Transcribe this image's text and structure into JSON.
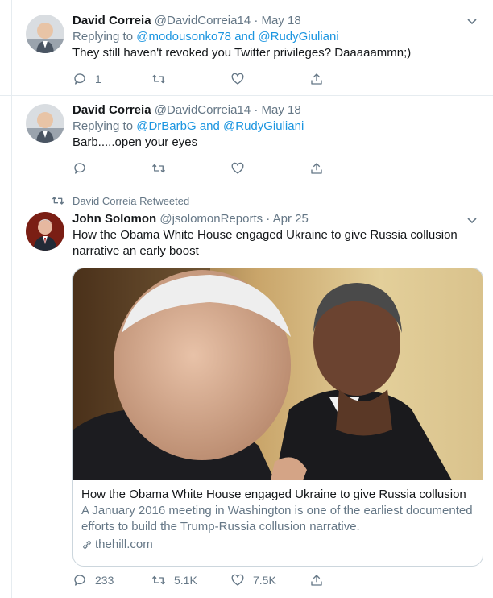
{
  "tweets": [
    {
      "name": "David Correia",
      "handle": "@DavidCorreia14",
      "sep": "·",
      "date": "May 18",
      "replying_prefix": "Replying to",
      "replying_1": "@modousonko78",
      "and": "and",
      "replying_2": "@RudyGiuliani",
      "text": "They still haven't revoked you Twitter privileges? Daaaaammn;)",
      "reply_count": "1"
    },
    {
      "name": "David Correia",
      "handle": "@DavidCorreia14",
      "sep": "·",
      "date": "May 18",
      "replying_prefix": "Replying to",
      "replying_1": "@DrBarbG",
      "and": "and",
      "replying_2": "@RudyGiuliani",
      "text": "Barb.....open your eyes"
    }
  ],
  "retweet": {
    "context": "David Correia Retweeted",
    "name": "John Solomon",
    "handle": "@jsolomonReports",
    "sep": "·",
    "date": "Apr 25",
    "text_line1": "How the Obama White House engaged Ukraine to give Russia collusion",
    "text_line2": "narrative an early boost",
    "card": {
      "title": "How the Obama White House engaged Ukraine to give Russia collusion",
      "desc_line1": "A January 2016 meeting in Washington is one of the earliest documented",
      "desc_line2": "efforts to build the Trump-Russia collusion narrative.",
      "domain": "thehill.com"
    },
    "reply_count": "233",
    "retweet_count": "5.1K",
    "like_count": "7.5K"
  },
  "icons": [
    "reply-icon",
    "retweet-icon",
    "like-icon",
    "share-icon",
    "chevron-down-icon",
    "link-icon"
  ],
  "colors": {
    "link": "#1b95e0",
    "muted": "#657786",
    "border": "#e6ecf0",
    "text": "#14171a"
  }
}
